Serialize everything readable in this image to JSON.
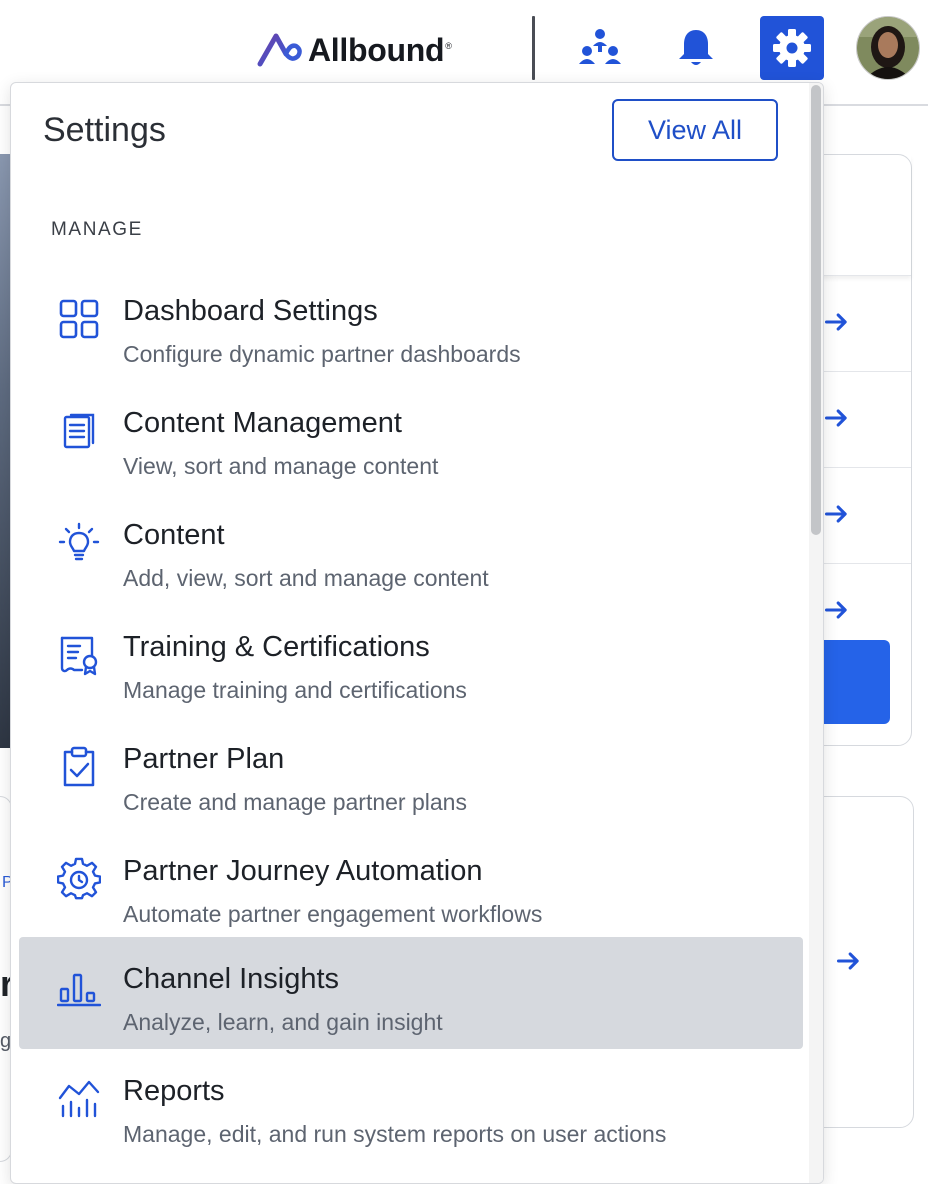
{
  "header": {
    "brand": "Allbound",
    "brand_mark": "®",
    "icons": {
      "partners": "partners-icon",
      "notifications": "bell-icon",
      "settings": "gear-icon"
    },
    "accent_color": "#2153d8"
  },
  "settings_menu": {
    "title": "Settings",
    "view_all_label": "View All",
    "section_label": "MANAGE",
    "items": [
      {
        "icon": "dashboard-grid-icon",
        "title": "Dashboard Settings",
        "description": "Configure dynamic partner dashboards"
      },
      {
        "icon": "document-icon",
        "title": "Content Management",
        "description": "View, sort and manage content"
      },
      {
        "icon": "lightbulb-icon",
        "title": "Content",
        "description": "Add, view, sort and manage content"
      },
      {
        "icon": "certificate-icon",
        "title": "Training & Certifications",
        "description": "Manage training and certifications"
      },
      {
        "icon": "clipboard-check-icon",
        "title": "Partner Plan",
        "description": "Create and manage partner plans"
      },
      {
        "icon": "gear-cycle-icon",
        "title": "Partner Journey Automation",
        "description": "Automate partner engagement workflows"
      },
      {
        "icon": "bar-chart-icon",
        "title": "Channel Insights",
        "description": "Analyze, learn, and gain insight",
        "active": true
      },
      {
        "icon": "reports-icon",
        "title": "Reports",
        "description": "Manage, edit, and run system reports on user actions"
      }
    ]
  },
  "background_fragments": {
    "f1": "P",
    "f2": "r",
    "f3": "g"
  }
}
